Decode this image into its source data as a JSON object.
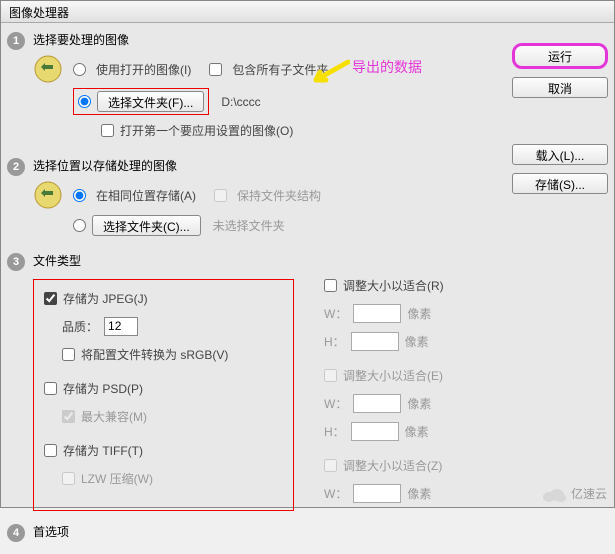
{
  "title": "图像处理器",
  "annotation": "导出的数据",
  "sidebar": {
    "run": "运行",
    "cancel": "取消",
    "load": "载入(L)...",
    "save": "存储(S)..."
  },
  "section1": {
    "num": "1",
    "title": "选择要处理的图像",
    "useOpen": "使用打开的图像(I)",
    "includeSub": "包含所有子文件夹",
    "selectFolder": "选择文件夹(F)...",
    "path": "D:\\cccc",
    "openFirst": "打开第一个要应用设置的图像(O)"
  },
  "section2": {
    "num": "2",
    "title": "选择位置以存储处理的图像",
    "sameLoc": "在相同位置存储(A)",
    "keepStruct": "保持文件夹结构",
    "selectFolder": "选择文件夹(C)...",
    "noFolder": "未选择文件夹"
  },
  "section3": {
    "num": "3",
    "title": "文件类型",
    "jpeg": {
      "label": "存储为 JPEG(J)",
      "quality": "品质：",
      "qualityVal": "12",
      "convert": "将配置文件转换为 sRGB(V)",
      "resize": "调整大小以适合(R)"
    },
    "psd": {
      "label": "存储为 PSD(P)",
      "maxCompat": "最大兼容(M)",
      "resize": "调整大小以适合(E)"
    },
    "tiff": {
      "label": "存储为 TIFF(T)",
      "lzw": "LZW 压缩(W)",
      "resize": "调整大小以适合(Z)"
    },
    "w": "W：",
    "h": "H：",
    "px": "像素"
  },
  "section4": {
    "num": "4",
    "title": "首选项"
  },
  "watermark": "亿速云"
}
